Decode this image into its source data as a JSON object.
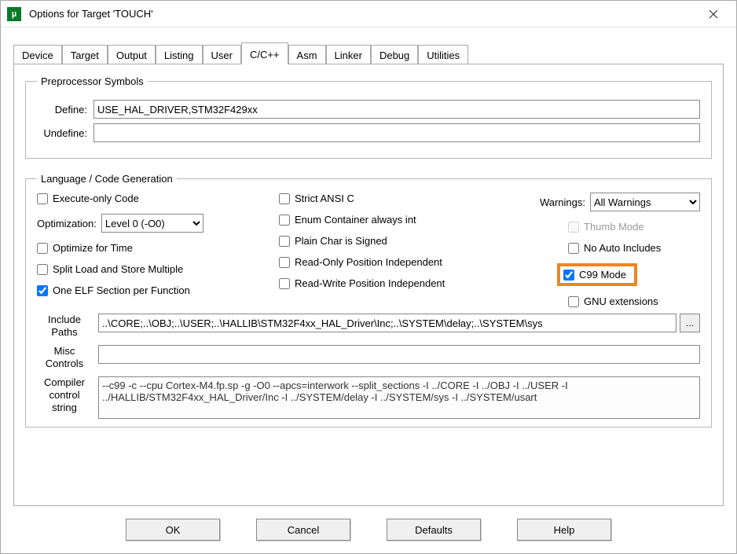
{
  "window": {
    "title": "Options for Target 'TOUCH'"
  },
  "tabs": {
    "device": "Device",
    "target": "Target",
    "output": "Output",
    "listing": "Listing",
    "user": "User",
    "ccpp": "C/C++",
    "asm": "Asm",
    "linker": "Linker",
    "debug": "Debug",
    "utilities": "Utilities",
    "active": "ccpp"
  },
  "preproc": {
    "legend": "Preprocessor Symbols",
    "define_label": "Define:",
    "define_value": "USE_HAL_DRIVER,STM32F429xx",
    "undefine_label": "Undefine:",
    "undefine_value": ""
  },
  "codegen": {
    "legend": "Language / Code Generation",
    "execute_only": {
      "label": "Execute-only Code",
      "checked": false
    },
    "optimization_label": "Optimization:",
    "optimization_value": "Level 0 (-O0)",
    "optimize_for_time": {
      "label": "Optimize for Time",
      "checked": false
    },
    "split_load_store": {
      "label": "Split Load and Store Multiple",
      "checked": false
    },
    "one_elf_section": {
      "label": "One ELF Section per Function",
      "checked": true
    },
    "strict_ansi": {
      "label": "Strict ANSI C",
      "checked": false
    },
    "enum_container": {
      "label": "Enum Container always int",
      "checked": false
    },
    "plain_char_signed": {
      "label": "Plain Char is Signed",
      "checked": false
    },
    "ro_pos_indep": {
      "label": "Read-Only Position Independent",
      "checked": false
    },
    "rw_pos_indep": {
      "label": "Read-Write Position Independent",
      "checked": false
    },
    "warnings_label": "Warnings:",
    "warnings_value": "All Warnings",
    "thumb_mode": {
      "label": "Thumb Mode",
      "checked": false,
      "disabled": true
    },
    "no_auto_includes": {
      "label": "No Auto Includes",
      "checked": false
    },
    "c99_mode": {
      "label": "C99 Mode",
      "checked": true
    },
    "gnu_ext": {
      "label": "GNU extensions",
      "checked": false
    }
  },
  "paths": {
    "include_label_1": "Include",
    "include_label_2": "Paths",
    "include_value": "..\\CORE;..\\OBJ;..\\USER;..\\HALLIB\\STM32F4xx_HAL_Driver\\Inc;..\\SYSTEM\\delay;..\\SYSTEM\\sys",
    "misc_label_1": "Misc",
    "misc_label_2": "Controls",
    "misc_value": "",
    "cc_label_1": "Compiler",
    "cc_label_2": "control",
    "cc_label_3": "string",
    "cc_value": "--c99 -c --cpu Cortex-M4.fp.sp -g -O0 --apcs=interwork --split_sections -I ../CORE -I ../OBJ -I ../USER -I ../HALLIB/STM32F4xx_HAL_Driver/Inc -I ../SYSTEM/delay -I ../SYSTEM/sys -I ../SYSTEM/usart",
    "browse_label": "..."
  },
  "buttons": {
    "ok": "OK",
    "cancel": "Cancel",
    "defaults": "Defaults",
    "help": "Help"
  }
}
